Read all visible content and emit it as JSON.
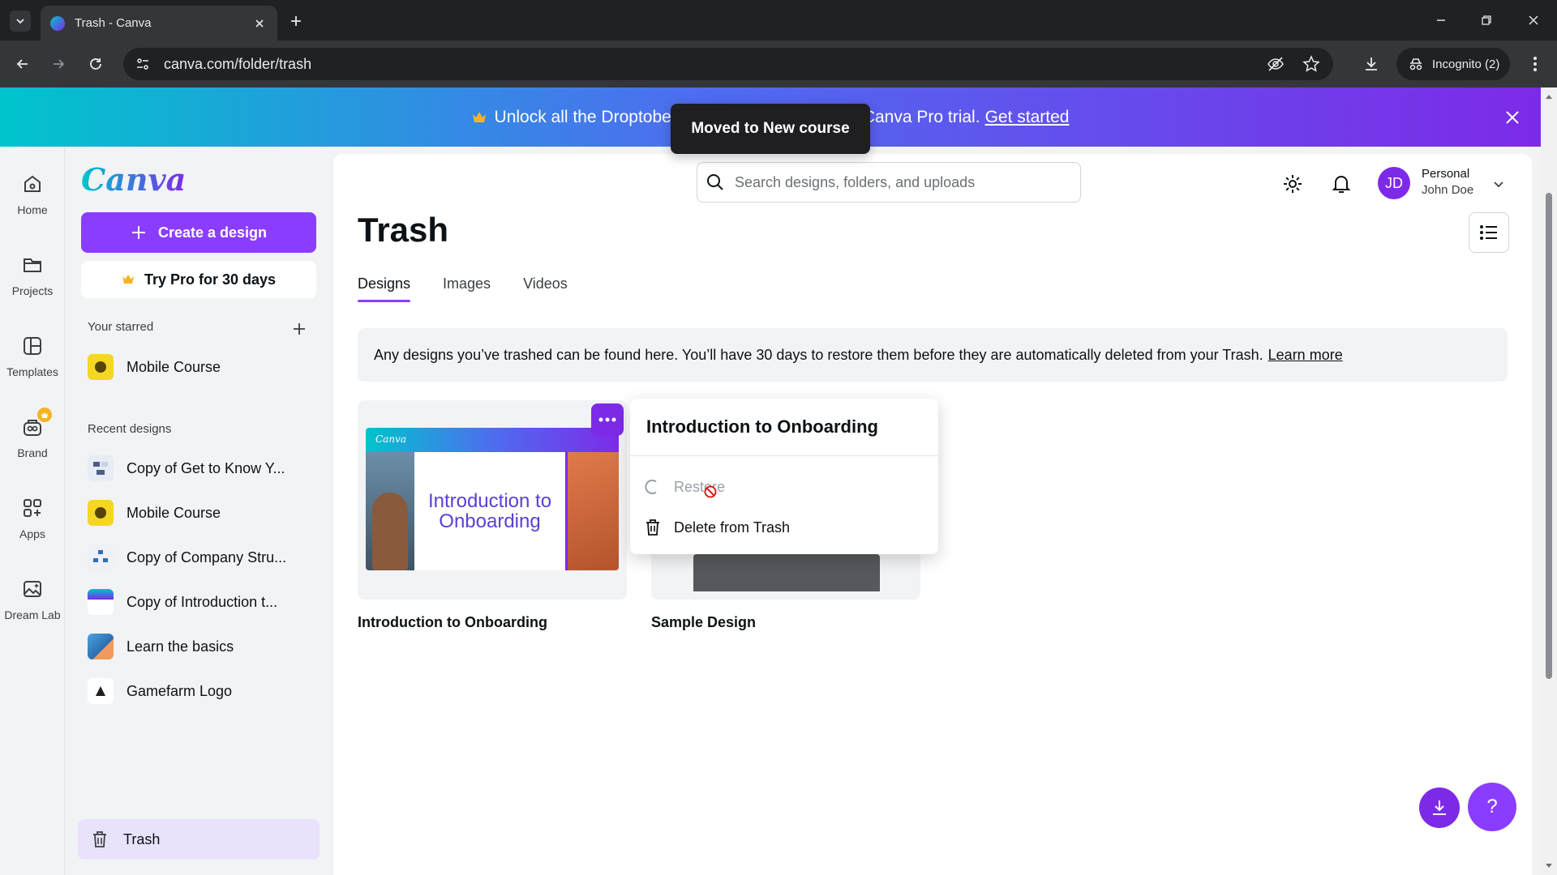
{
  "browser": {
    "tab_title": "Trash - Canva",
    "url": "canva.com/folder/trash",
    "incognito_label": "Incognito (2)"
  },
  "banner": {
    "text_left": "Unlock all the Droptobe",
    "text_right": "Canva Pro trial.",
    "link": "Get started"
  },
  "toast": {
    "text": "Moved to New course"
  },
  "rail": {
    "home": "Home",
    "projects": "Projects",
    "templates": "Templates",
    "brand": "Brand",
    "apps": "Apps",
    "dreamlab": "Dream Lab"
  },
  "sidebar": {
    "logo": "Canva",
    "create_label": "Create a design",
    "trypro_label": "Try Pro for 30 days",
    "starred_title": "Your starred",
    "starred": [
      {
        "label": "Mobile Course"
      }
    ],
    "recent_title": "Recent designs",
    "recent": [
      {
        "label": "Copy of Get to Know Y..."
      },
      {
        "label": "Mobile Course"
      },
      {
        "label": "Copy of Company Stru..."
      },
      {
        "label": "Copy of Introduction t..."
      },
      {
        "label": "Learn the basics"
      },
      {
        "label": "Gamefarm Logo"
      }
    ],
    "trash_label": "Trash"
  },
  "header": {
    "search_placeholder": "Search designs, folders, and uploads",
    "account_type": "Personal",
    "account_name": "John Doe",
    "avatar_initials": "JD"
  },
  "main": {
    "title": "Trash",
    "tabs": [
      {
        "label": "Designs"
      },
      {
        "label": "Images"
      },
      {
        "label": "Videos"
      }
    ],
    "info_text": "Any designs you’ve trashed can be found here. You’ll have 30 days to restore them before they are automatically deleted from your Trash.",
    "info_link": "Learn more",
    "designs": [
      {
        "title": "Introduction to Onboarding",
        "thumb_brand": "Canva",
        "thumb_text": "Introduction to Onboarding"
      },
      {
        "title": "Sample Design"
      }
    ]
  },
  "context_menu": {
    "title": "Introduction to Onboarding",
    "restore": "Restore",
    "delete": "Delete from Trash"
  },
  "fab": {
    "help": "?"
  }
}
